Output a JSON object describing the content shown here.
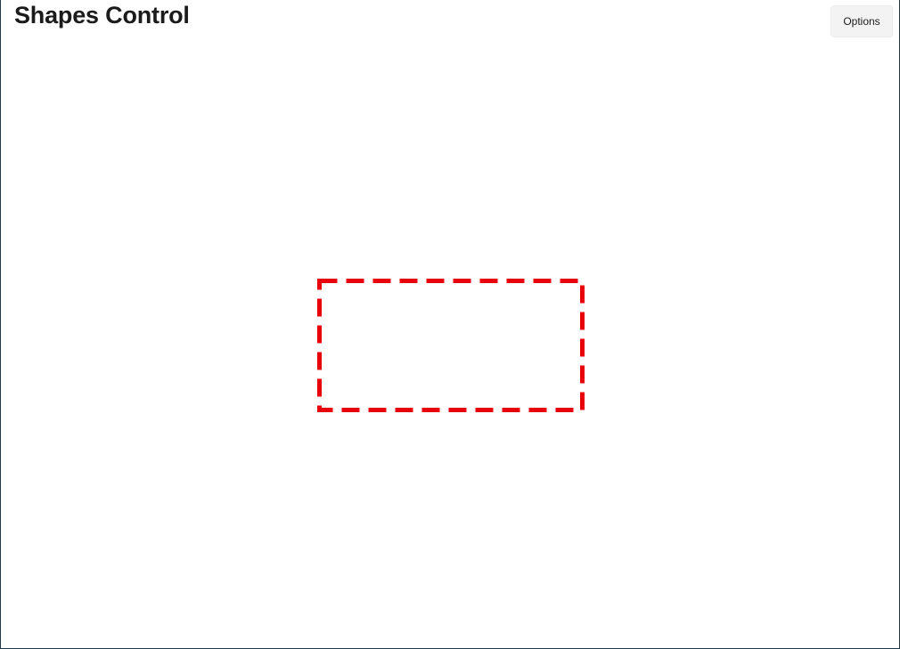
{
  "window": {
    "title": "Shapes Control"
  },
  "toolbar": {
    "options_label": "Options"
  },
  "shape": {
    "type": "rectangle",
    "stroke_color": "#e8000b",
    "fill": "none",
    "stroke_style": "dashed"
  }
}
